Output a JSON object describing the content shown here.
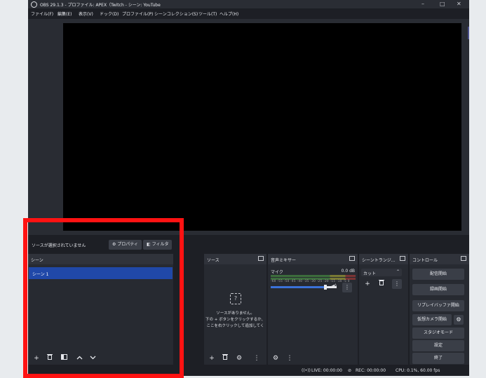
{
  "titlebar": {
    "title": "OBS 29.1.3 - プロファイル: APEX（Twitch - シーン: YouTube",
    "minimize": "–",
    "maximize": "□",
    "close": "✕"
  },
  "menu": [
    "ファイル(F)",
    "編集(E)",
    "表示(V)",
    "ドック(D)",
    "プロファイル(P)",
    "シーンコレクション(S)",
    "ツール(T)",
    "ヘルプ(H)"
  ],
  "source_bar": {
    "no_source": "ソースが選択されていません",
    "properties": "⚙ プロパティ",
    "filters": "◧ フィルタ"
  },
  "scenes": {
    "title": "シーン",
    "items": [
      "シーン 1"
    ]
  },
  "sources": {
    "title": "ソース",
    "empty_line1": "ソースがありません。",
    "empty_line2": "下の + ボタンをクリックするか、",
    "empty_line3": "ここを右クリックして追加してく"
  },
  "mixer": {
    "title": "音声ミキサー",
    "channel": "マイク",
    "db": "0.0 dB",
    "scale": "-60 -55 -50 -45 -40 -35 -30 -25 -20 -15 -10 -5 0"
  },
  "transitions": {
    "title": "シーントランジ...",
    "selected": "カット"
  },
  "controls": {
    "title": "コントロール",
    "buttons": [
      "配信開始",
      "録画開始",
      "リプレイバッファ開始",
      "仮想カメラ開始",
      "スタジオモード",
      "設定",
      "終了"
    ]
  },
  "status": {
    "live": "LIVE: 00:00:00",
    "rec": "REC: 00:00:00",
    "cpu": "CPU: 0.1%, 60.00 fps"
  },
  "colors": {
    "highlight": "#ff1212",
    "selection": "#2048a8"
  }
}
